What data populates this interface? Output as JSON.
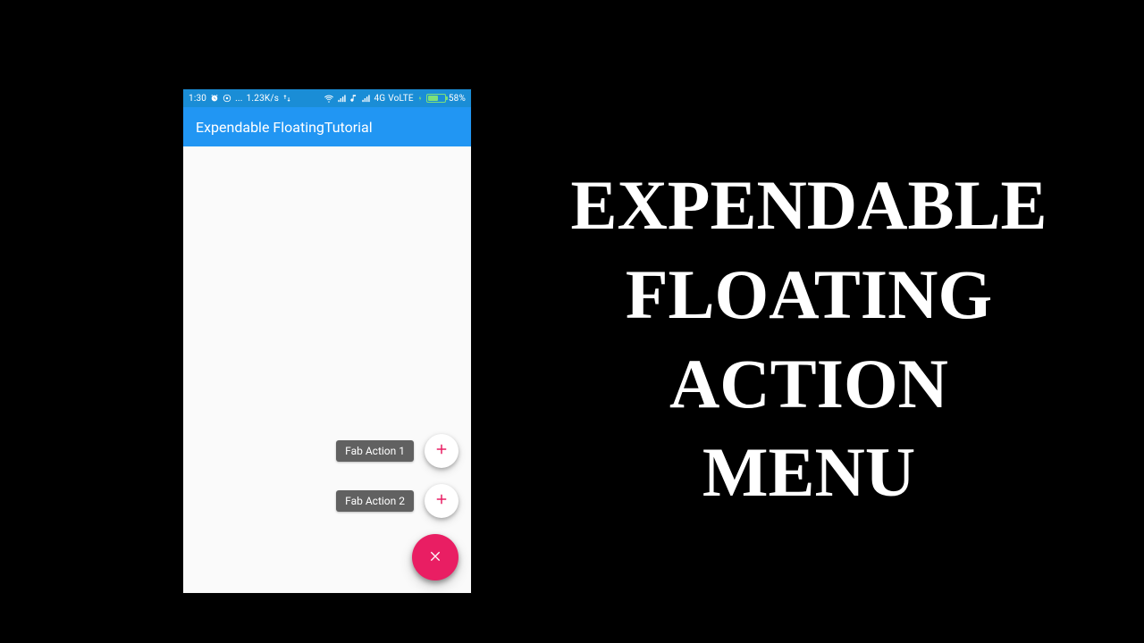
{
  "headline": "EXPENDABLE\nFLOATING\nACTION\nMENU",
  "statusbar": {
    "time": "1:30",
    "rate": "1.23K/s",
    "network": "4G",
    "volte": "VoLTE",
    "battery_pct": "58%"
  },
  "appbar": {
    "title": "Expendable FloatingTutorial"
  },
  "fab": {
    "actions": [
      {
        "label": "Fab Action 1"
      },
      {
        "label": "Fab Action 2"
      }
    ]
  },
  "colors": {
    "primary": "#2196f3",
    "accent": "#e91e63",
    "plus": "#e91e63",
    "status": "#1a8dd6",
    "battery": "#7de07a",
    "label_bg": "#616161"
  }
}
